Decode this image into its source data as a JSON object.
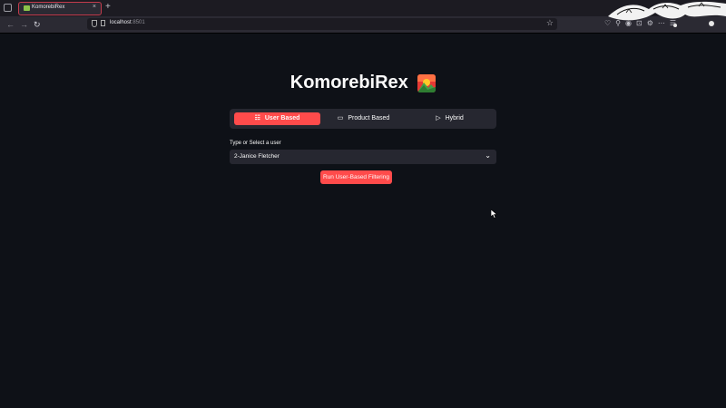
{
  "browser": {
    "tab_title": "KomorebiRex",
    "tab_close": "×",
    "new_tab": "+",
    "url_host": "localhost",
    "url_port": ":8501",
    "back_glyph": "←",
    "forward_glyph": "→",
    "reload_glyph": "↻",
    "star_glyph": "☆",
    "extension_glyphs": "♡⚲◉⊡⚙⋯☰",
    "colors": {
      "tab_border": "#c43b4c",
      "toolbar": "#2b2a33",
      "tabstrip": "#1c1b22"
    }
  },
  "app": {
    "title": "KomorebiRex",
    "tabs": [
      {
        "label": "User Based",
        "icon": "list-icon",
        "glyph": "☷",
        "active": true
      },
      {
        "label": "Product Based",
        "icon": "folder-icon",
        "glyph": "▭",
        "active": false
      },
      {
        "label": "Hybrid",
        "icon": "play-icon",
        "glyph": "▷",
        "active": false
      }
    ],
    "select_label": "Type or Select a user",
    "select_value": "2-Janice Fletcher",
    "select_chevron": "⌄",
    "run_button": "Run User-Based Filtering",
    "colors": {
      "background": "#0e1117",
      "accent": "#ff4b4b",
      "widget_bg": "#262730"
    }
  }
}
